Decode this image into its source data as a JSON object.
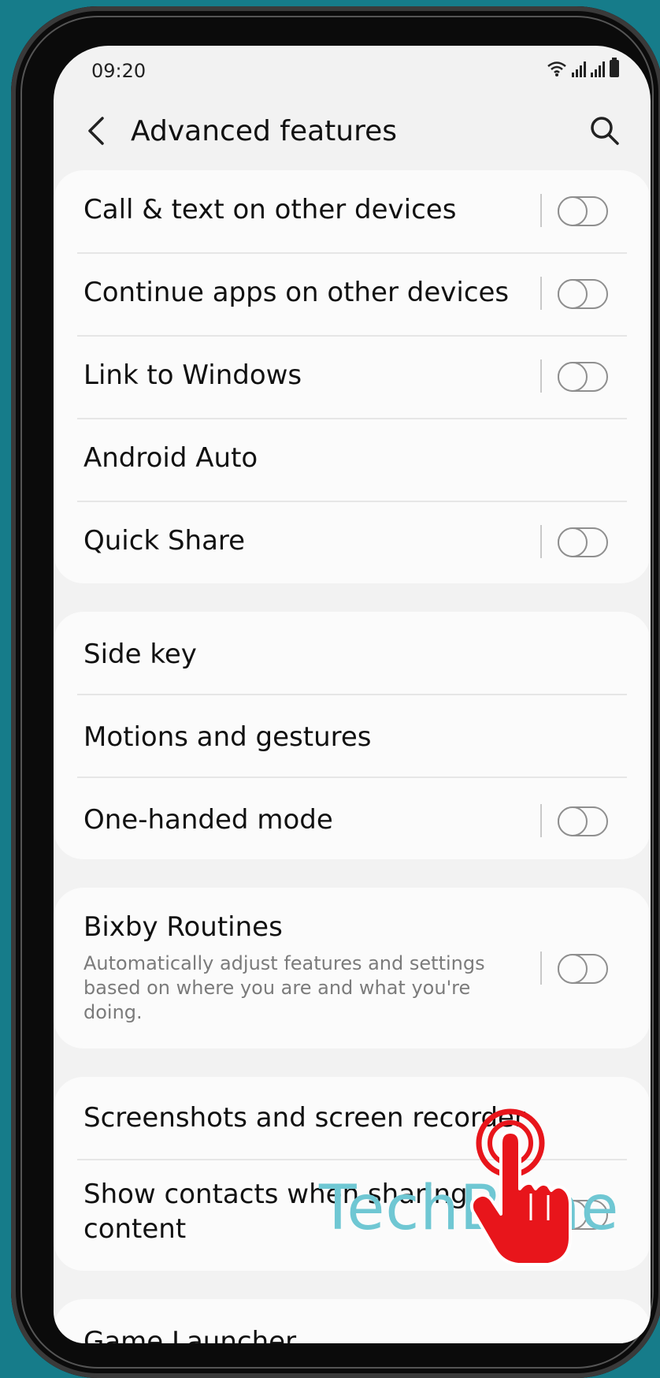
{
  "status_bar": {
    "time": "09:20"
  },
  "header": {
    "title": "Advanced features"
  },
  "groups": [
    {
      "items": [
        {
          "label": "Call & text on other devices",
          "toggle": true,
          "on": false
        },
        {
          "label": "Continue apps on other devices",
          "toggle": true,
          "on": false
        },
        {
          "label": "Link to Windows",
          "toggle": true,
          "on": false
        },
        {
          "label": "Android Auto",
          "toggle": false
        },
        {
          "label": "Quick Share",
          "toggle": true,
          "on": false
        }
      ]
    },
    {
      "items": [
        {
          "label": "Side key",
          "toggle": false
        },
        {
          "label": "Motions and gestures",
          "toggle": false
        },
        {
          "label": "One-handed mode",
          "toggle": true,
          "on": false
        }
      ]
    },
    {
      "items": [
        {
          "label": "Bixby Routines",
          "sub_line1": "Automatically adjust features and settings",
          "sub_line2": "based on where you are and what you're",
          "sub_line3": "doing.",
          "toggle": true,
          "on": false
        }
      ]
    },
    {
      "items": [
        {
          "label": "Screenshots and screen recorder",
          "toggle": false
        },
        {
          "label_line1": "Show contacts when sharing",
          "label_line2": "content",
          "toggle": true,
          "on": false
        }
      ]
    },
    {
      "items": [
        {
          "label": "Game Launcher",
          "toggle": false
        }
      ]
    }
  ],
  "overlay": {
    "watermark": "TechBone",
    "tap_icon": "tap-hand-icon"
  },
  "colors": {
    "background": "#167c8a",
    "screen": "#f2f2f2",
    "card": "#fbfbfb",
    "tap_hand": "#e8151b",
    "watermark": "#6fc7d3"
  }
}
